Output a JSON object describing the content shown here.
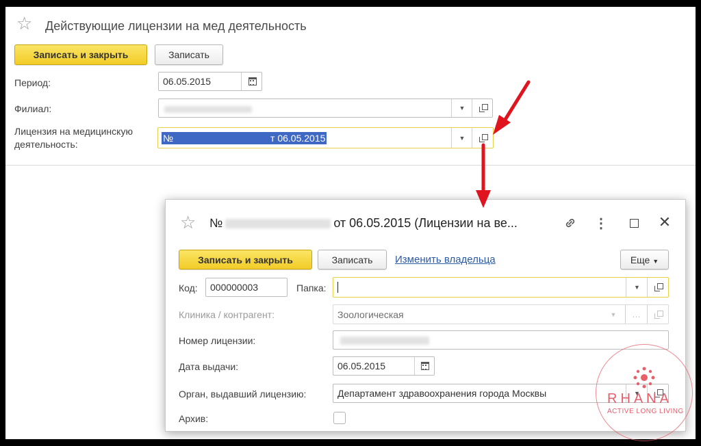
{
  "main": {
    "title": "Действующие лицензии на мед деятельность",
    "save_close_label": "Записать и закрыть",
    "save_label": "Записать",
    "period": {
      "label": "Период:",
      "value": "06.05.2015"
    },
    "branch": {
      "label": "Филиал:",
      "value": ""
    },
    "license": {
      "label_line1": "Лицензия на медицинскую",
      "label_line2": "деятельность:",
      "prefix": "№",
      "suffix": "т 06.05.2015"
    }
  },
  "dialog": {
    "title_prefix": "№",
    "title_suffix": "от 06.05.2015 (Лицензии на ве...",
    "save_close_label": "Записать и закрыть",
    "save_label": "Записать",
    "change_owner_label": "Изменить владельца",
    "more_label": "Еще",
    "code": {
      "label": "Код:",
      "value": "000000003"
    },
    "folder": {
      "label": "Папка:",
      "value": ""
    },
    "clinic": {
      "label": "Клиника / контрагент:",
      "value": "Зоологическая"
    },
    "license_number": {
      "label": "Номер лицензии:",
      "value": ""
    },
    "issue_date": {
      "label": "Дата выдачи:",
      "value": "06.05.2015"
    },
    "issuer": {
      "label": "Орган, выдавший лицензию:",
      "value": "Департамент здравоохранения города Москвы"
    },
    "archive": {
      "label": "Архив:",
      "checked": false
    }
  },
  "watermark": {
    "brand": "RHANA",
    "tagline": "ACTIVE LONG LIVING"
  },
  "colors": {
    "primary_button": "#f2cc28",
    "link": "#2a5aa6",
    "arrow": "#e0141e",
    "selection": "#3f68c4",
    "watermark": "#e85f6c"
  },
  "icons": {
    "favorite": "star-outline-icon",
    "calendar": "calendar-icon",
    "dropdown": "chevron-down-icon",
    "open": "open-form-icon",
    "link": "link-icon",
    "menu": "more-vertical-icon",
    "maximize": "maximize-icon",
    "close": "close-icon"
  }
}
